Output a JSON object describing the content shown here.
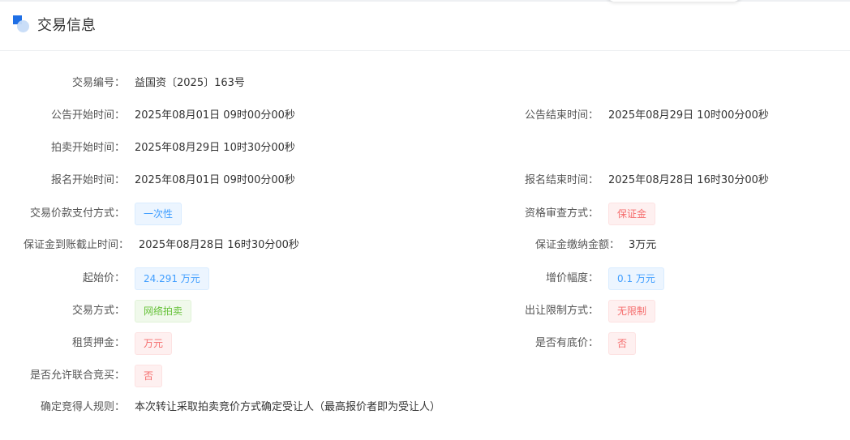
{
  "section": {
    "title": "交易信息"
  },
  "fields": {
    "trade_no": {
      "label": "交易编号：",
      "value": "益国资〔2025〕163号"
    },
    "notice_start": {
      "label": "公告开始时间：",
      "value": "2025年08月01日 09时00分00秒"
    },
    "notice_end": {
      "label": "公告结束时间：",
      "value": "2025年08月29日 10时00分00秒"
    },
    "auction_start": {
      "label": "拍卖开始时间：",
      "value": "2025年08月29日 10时30分00秒"
    },
    "signup_start": {
      "label": "报名开始时间：",
      "value": "2025年08月01日 09时00分00秒"
    },
    "signup_end": {
      "label": "报名结束时间：",
      "value": "2025年08月28日 16时30分00秒"
    },
    "payment_method": {
      "label": "交易价款支付方式：",
      "value": "一次性"
    },
    "qualify_method": {
      "label": "资格审查方式：",
      "value": "保证金"
    },
    "deposit_deadline": {
      "label": "保证金到账截止时间：",
      "value": "2025年08月28日 16时30分00秒"
    },
    "deposit_amount": {
      "label": "保证金缴纳金额：",
      "value": "3万元"
    },
    "start_price": {
      "label": "起始价：",
      "value": "24.291 万元"
    },
    "increment": {
      "label": "增价幅度：",
      "value": "0.1 万元"
    },
    "trade_method": {
      "label": "交易方式：",
      "value": "网络拍卖"
    },
    "transfer_limit": {
      "label": "出让限制方式：",
      "value": "无限制"
    },
    "lease_deposit": {
      "label": "租赁押金：",
      "value": "万元"
    },
    "reserve_price": {
      "label": "是否有底价：",
      "value": "否"
    },
    "joint_bid": {
      "label": "是否允许联合竞买：",
      "value": "否"
    },
    "winner_rule": {
      "label": "确定竞得人规则：",
      "value": "本次转让采取拍卖竞价方式确定受让人（最高报价者即为受让人）"
    }
  },
  "icons": {
    "header": "section-title-icon"
  },
  "colors": {
    "accent": "#1f6fe5",
    "tag_blue": "#409eff",
    "tag_green": "#67c23a",
    "tag_red": "#f56c6c"
  }
}
